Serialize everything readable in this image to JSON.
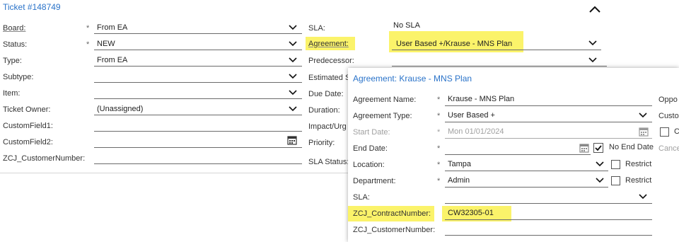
{
  "ticket": {
    "title": "Ticket #148749",
    "left_fields": [
      {
        "label": "Board:",
        "required": "*",
        "value": "From EA"
      },
      {
        "label": "Status:",
        "required": "*",
        "value": "NEW"
      },
      {
        "label": "Type:",
        "required": "",
        "value": "From EA"
      },
      {
        "label": "Subtype:",
        "required": "",
        "value": ""
      },
      {
        "label": "Item:",
        "required": "",
        "value": ""
      },
      {
        "label": "Ticket Owner:",
        "required": "",
        "value": "(Unassigned)"
      },
      {
        "label": "CustomField1:",
        "required": "",
        "value": ""
      },
      {
        "label": "CustomField2:",
        "required": "",
        "value": ""
      },
      {
        "label": "ZCJ_CustomerNumber:",
        "required": "",
        "value": ""
      }
    ],
    "mid_fields": {
      "sla_label": "SLA:",
      "sla_value": "No SLA",
      "agreement_label": "Agreement:",
      "agreement_value": "User Based +/Krause - MNS Plan",
      "predecessor_label": "Predecessor:",
      "estimated_label": "Estimated S",
      "due_date_label": "Due Date:",
      "duration_label": "Duration:",
      "impact_label": "Impact/Urg",
      "priority_label": "Priority:",
      "sla_status_label": "SLA Status:"
    }
  },
  "agreement_panel": {
    "title": "Agreement: Krause - MNS Plan",
    "name_label": "Agreement Name:",
    "name_value": "Krause - MNS Plan",
    "type_label": "Agreement Type:",
    "type_value": "User Based +",
    "start_label": "Start Date:",
    "start_value": "Mon 01/01/2024",
    "end_label": "End Date:",
    "no_end_label": "No End Date",
    "location_label": "Location:",
    "location_value": "Tampa",
    "department_label": "Department:",
    "department_value": "Admin",
    "restrict_label": "Restrict",
    "sla_label": "SLA:",
    "sla_value": "",
    "contract_label": "ZCJ_ContractNumber:",
    "contract_value": "CW32305-01",
    "customer_label": "ZCJ_CustomerNumber:",
    "customer_value": "",
    "required": "*",
    "right_col": {
      "oppo": "Oppo",
      "custo": "Custo",
      "c": "C",
      "cance": "Cance"
    }
  },
  "colors": {
    "title_blue": "#2a73c9",
    "highlight": "#fbf36a"
  }
}
